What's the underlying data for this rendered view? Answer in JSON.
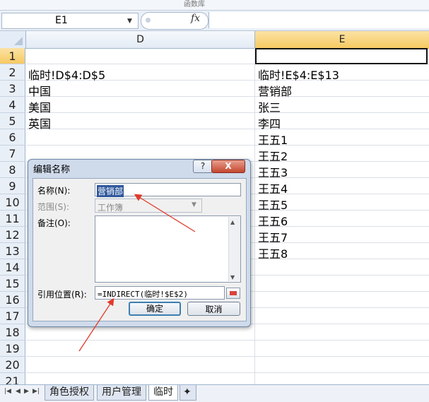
{
  "ribbon": {
    "group_label": "函数库"
  },
  "formula_bar": {
    "name_box": "E1",
    "fx_label": "fx",
    "formula": ""
  },
  "columns": [
    "D",
    "E"
  ],
  "rows": [
    "1",
    "2",
    "3",
    "4",
    "5",
    "6",
    "7",
    "8",
    "9",
    "10",
    "11",
    "12",
    "13",
    "14",
    "15",
    "16",
    "17",
    "18",
    "19",
    "20",
    "21"
  ],
  "cells_d": {
    "2": "临时!D$4:D$5",
    "3": "中国",
    "4": "美国",
    "5": "英国"
  },
  "cells_e": {
    "2": "临时!E$4:E$13",
    "3": "营销部",
    "4": "张三",
    "5": "李四",
    "6": "王五1",
    "7": "王五2",
    "8": "王五3",
    "9": "王五4",
    "10": "王五5",
    "11": "王五6",
    "12": "王五7",
    "13": "王五8"
  },
  "sheet_tabs": [
    {
      "label": "角色授权",
      "active": false
    },
    {
      "label": "用户管理",
      "active": false
    },
    {
      "label": "临时",
      "active": true
    }
  ],
  "dialog": {
    "title": "编辑名称",
    "help": "?",
    "close": "X",
    "name_label": "名称(N):",
    "name_value": "营销部",
    "scope_label": "范围(S):",
    "scope_value": "工作簿",
    "comment_label": "备注(O):",
    "comment_value": "",
    "refers_label": "引用位置(R):",
    "refers_value": "=INDIRECT(临时!$E$2)",
    "ok": "确定",
    "cancel": "取消"
  },
  "colors": {
    "selection_header": "#f6c962",
    "arrow": "#e03a2a",
    "dialog_frame": "#cfdbeb"
  }
}
